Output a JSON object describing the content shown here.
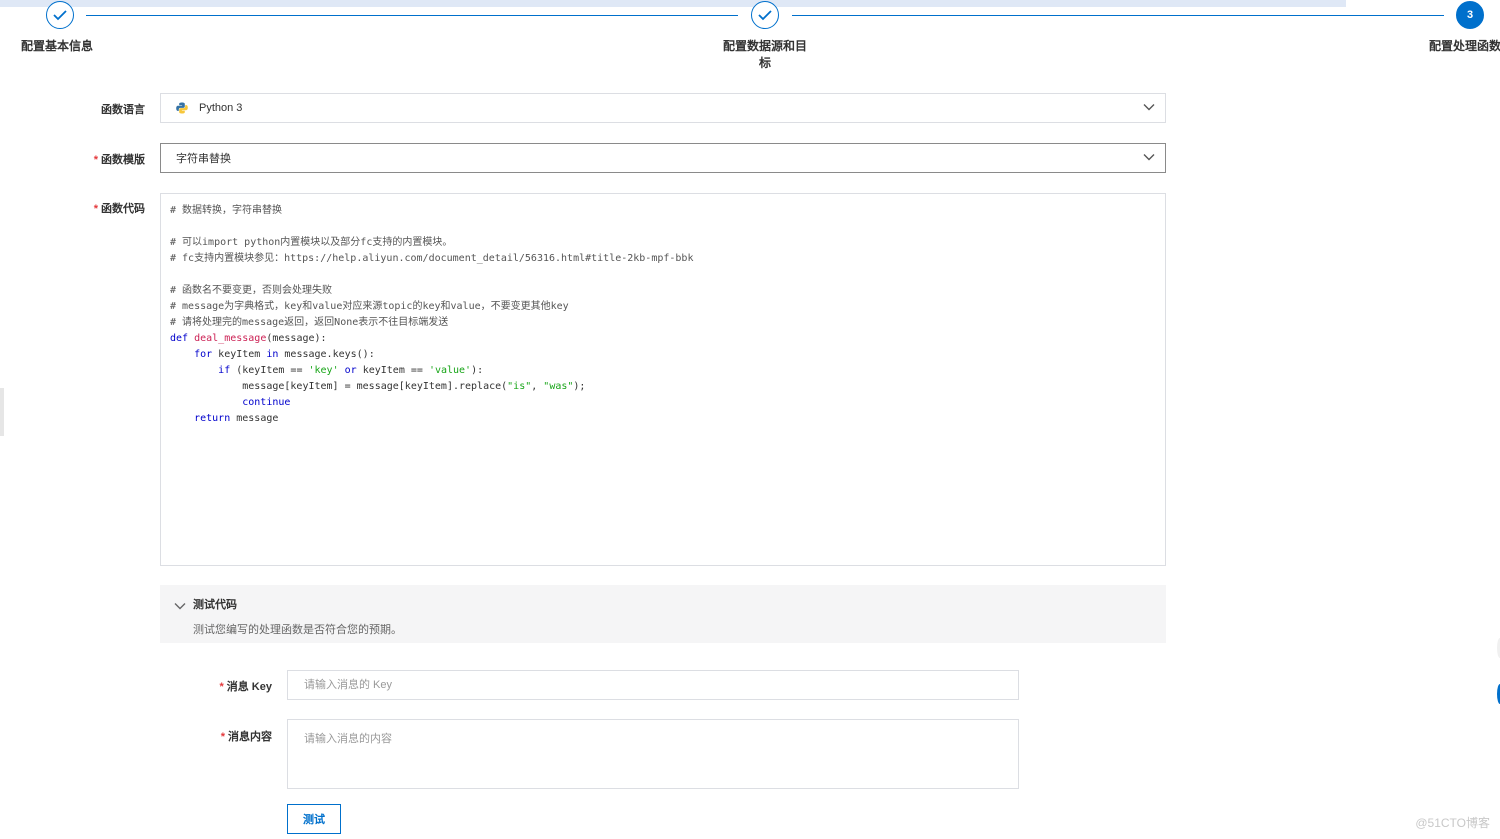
{
  "steps": [
    {
      "label": "配置基本信息"
    },
    {
      "label": "配置数据源和目标"
    },
    {
      "label": "配置处理函数",
      "number": "3"
    }
  ],
  "form": {
    "language": {
      "label": "函数语言",
      "value": "Python 3"
    },
    "template": {
      "label": "函数模版",
      "value": "字符串替换",
      "required_mark": "*"
    },
    "code": {
      "label": "函数代码",
      "required_mark": "*",
      "lines": [
        "# 数据转换，字符串替换",
        "",
        "# 可以import python内置模块以及部分fc支持的内置模块。",
        "# fc支持内置模块参见：https://help.aliyun.com/document_detail/56316.html#title-2kb-mpf-bbk",
        "",
        "# 函数名不要变更，否则会处理失败",
        "# message为字典格式，key和value对应来源topic的key和value，不要变更其他key",
        "# 请将处理完的message返回，返回None表示不往目标端发送",
        "def deal_message(message):",
        "    for keyItem in message.keys():",
        "        if (keyItem == 'key' or keyItem == 'value'):",
        "            message[keyItem] = message[keyItem].replace(\"is\", \"was\");",
        "            continue",
        "    return message"
      ]
    }
  },
  "test_panel": {
    "title": "测试代码",
    "description": "测试您编写的处理函数是否符合您的预期。"
  },
  "test_form": {
    "key_label": "消息 Key",
    "key_placeholder": "请输入消息的 Key",
    "content_label": "消息内容",
    "content_placeholder": "请输入消息的内容",
    "required_mark": "*",
    "test_button": "测试"
  },
  "watermark": "@51CTO博客",
  "colors": {
    "primary": "#0070cc",
    "required": "#e4393c"
  }
}
